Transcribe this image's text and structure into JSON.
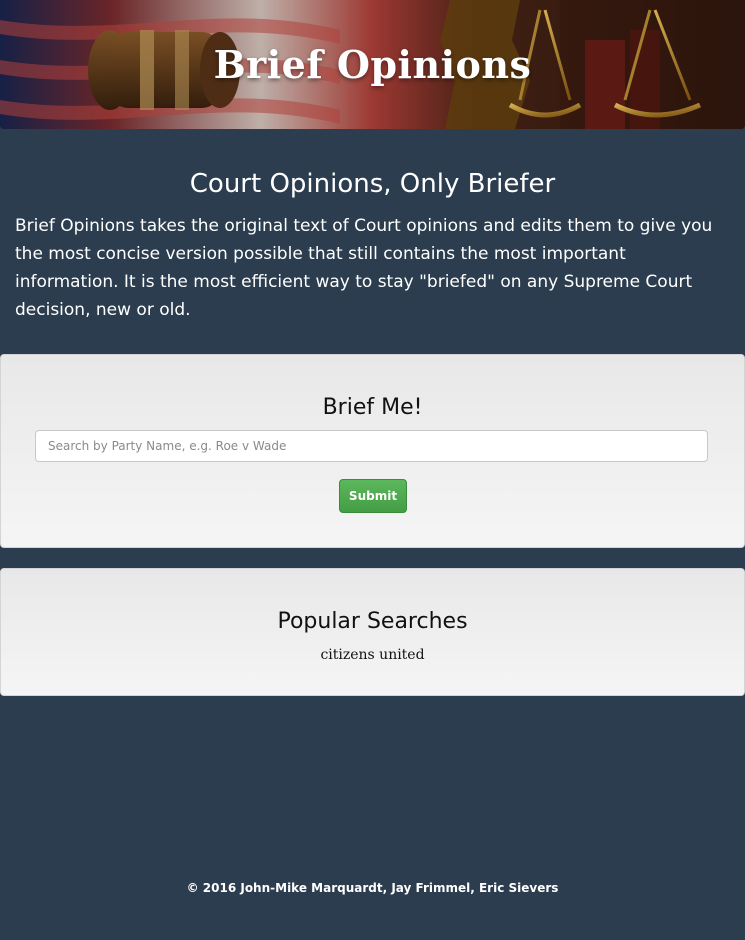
{
  "banner": {
    "title": "Brief Opinions"
  },
  "intro": {
    "heading": "Court Opinions, Only Briefer",
    "text": "Brief Opinions takes the original text of Court opinions and edits them to give you the most concise version possible that still contains the most important information. It is the most efficient way to stay \"briefed\" on any Supreme Court decision, new or old."
  },
  "search": {
    "heading": "Brief Me!",
    "placeholder": "Search by Party Name, e.g. Roe v Wade",
    "submit_label": "Submit"
  },
  "popular": {
    "heading": "Popular Searches",
    "items": [
      "citizens united"
    ]
  },
  "footer": {
    "text": "© 2016 John-Mike Marquardt, Jay Frimmel, Eric Sievers"
  },
  "colors": {
    "page_background": "#2b3d4f",
    "panel_background": "#f0f0f0",
    "submit_green": "#4cae4c"
  }
}
